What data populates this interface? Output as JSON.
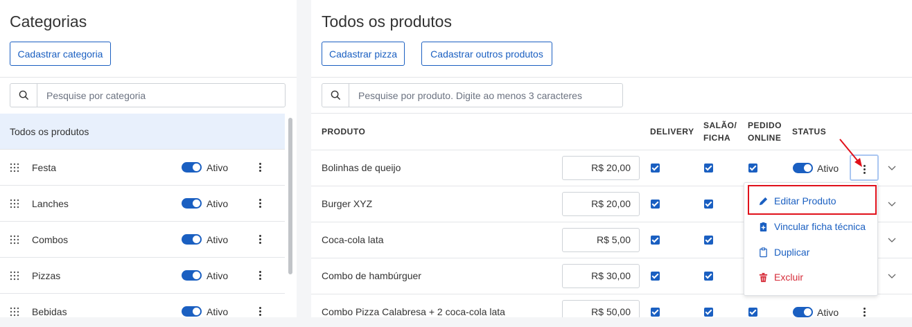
{
  "categories_panel": {
    "title": "Categorias",
    "add_button": "Cadastrar categoria",
    "search_placeholder": "Pesquise por categoria",
    "all_products_label": "Todos os produtos",
    "items": [
      {
        "name": "Festa",
        "status": "Ativo"
      },
      {
        "name": "Lanches",
        "status": "Ativo"
      },
      {
        "name": "Combos",
        "status": "Ativo"
      },
      {
        "name": "Pizzas",
        "status": "Ativo"
      },
      {
        "name": "Bebidas",
        "status": "Ativo"
      }
    ]
  },
  "products_panel": {
    "title": "Todos os produtos",
    "add_pizza_button": "Cadastrar pizza",
    "add_other_button": "Cadastrar outros produtos",
    "search_placeholder": "Pesquise por produto. Digite ao menos 3 caracteres",
    "columns": {
      "product": "PRODUTO",
      "delivery": "DELIVERY",
      "salao_1": "SALÃO/",
      "salao_2": "FICHA",
      "pedido_1": "PEDIDO",
      "pedido_2": "ONLINE",
      "status": "STATUS"
    },
    "rows": [
      {
        "name": "Bolinhas de queijo",
        "price": "R$ 20,00",
        "status": "Ativo"
      },
      {
        "name": "Burger XYZ",
        "price": "R$ 20,00",
        "status": ""
      },
      {
        "name": "Coca-cola lata",
        "price": "R$ 5,00",
        "status": ""
      },
      {
        "name": "Combo de hambúrguer",
        "price": "R$ 30,00",
        "status": ""
      },
      {
        "name": "Combo Pizza Calabresa + 2 coca-cola lata",
        "price": "R$ 50,00",
        "status": "Ativo"
      }
    ]
  },
  "context_menu": {
    "edit": "Editar Produto",
    "link_sheet": "Vincular ficha técnica",
    "duplicate": "Duplicar",
    "delete": "Excluir"
  },
  "colors": {
    "accent": "#1a5fc1",
    "danger": "#d62d3a",
    "highlight": "#e0101a",
    "selected_row": "#e8f0fc"
  }
}
